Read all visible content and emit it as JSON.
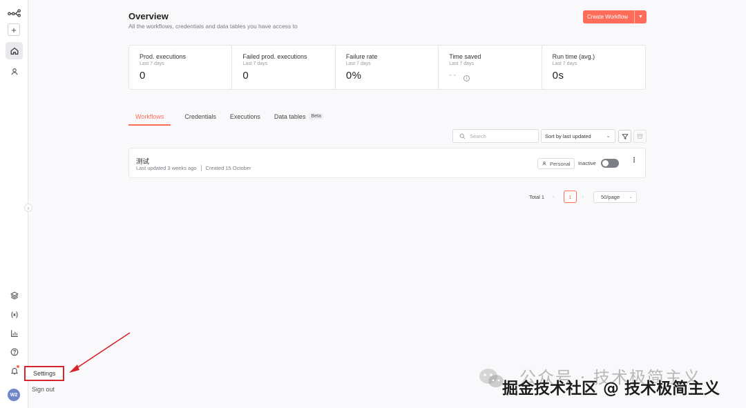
{
  "sidebar": {
    "add_label": "+",
    "avatar_initials": "W2",
    "icons": [
      "workflow-logo-icon",
      "add-icon",
      "home-icon",
      "user-icon",
      "templates-icon",
      "variables-icon",
      "insights-icon",
      "help-icon",
      "bell-icon"
    ]
  },
  "user_menu": {
    "settings_label": "Settings",
    "signout_label": "Sign out"
  },
  "header": {
    "title": "Overview",
    "subtitle": "All the workflows, credentials and data tables you have access to",
    "create_label": "Create Workflow"
  },
  "stats": [
    {
      "label": "Prod. executions",
      "period": "Last 7 days",
      "value": "0"
    },
    {
      "label": "Failed prod. executions",
      "period": "Last 7 days",
      "value": "0"
    },
    {
      "label": "Failure rate",
      "period": "Last 7 days",
      "value": "0%"
    },
    {
      "label": "Time saved",
      "period": "Last 7 days",
      "value": "--"
    },
    {
      "label": "Run time (avg.)",
      "period": "Last 7 days",
      "value": "0s"
    }
  ],
  "tabs": [
    {
      "label": "Workflows",
      "active": true
    },
    {
      "label": "Credentials"
    },
    {
      "label": "Executions"
    },
    {
      "label": "Data tables",
      "badge": "Beta"
    }
  ],
  "toolbar": {
    "search_placeholder": "Search",
    "sort_label": "Sort by last updated"
  },
  "workflow": {
    "name": "测试",
    "last_updated": "Last updated 3 weeks ago",
    "created": "Created 15 October",
    "owner": "Personal",
    "status": "Inactive",
    "more": "⋮"
  },
  "pagination": {
    "total": "Total 1",
    "page": "1",
    "per_page": "50/page"
  },
  "watermark": {
    "line1": "公众号 · 技术极简主义",
    "line2": "掘金技术社区 @ 技术极简主义"
  },
  "colors": {
    "accent": "#ff6d5a",
    "highlight_box": "#d7232b"
  }
}
